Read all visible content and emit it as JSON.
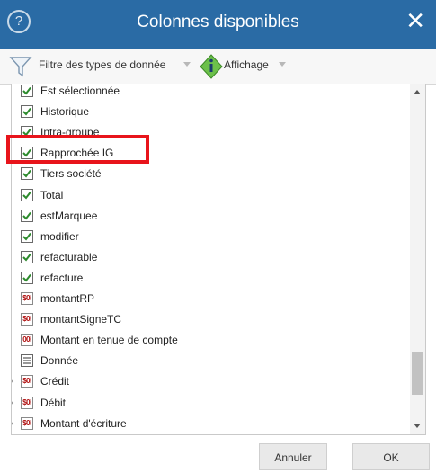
{
  "dialog": {
    "title": "Colonnes disponibles",
    "help_glyph": "?",
    "close_glyph": "✕"
  },
  "toolbar": {
    "filter_label": "Filtre des types de donnée",
    "display_label": "Affichage"
  },
  "columns": [
    {
      "label": "Est sélectionnée",
      "icon": "checkbox-checked"
    },
    {
      "label": "Historique",
      "icon": "checkbox-checked"
    },
    {
      "label": "Intra-groupe",
      "icon": "checkbox-checked"
    },
    {
      "label": "Rapprochée IG",
      "icon": "checkbox-checked"
    },
    {
      "label": "Tiers société",
      "icon": "checkbox-checked"
    },
    {
      "label": "Total",
      "icon": "checkbox-checked"
    },
    {
      "label": "estMarquee",
      "icon": "checkbox-checked"
    },
    {
      "label": "modifier",
      "icon": "checkbox-checked"
    },
    {
      "label": "refacturable",
      "icon": "checkbox-checked"
    },
    {
      "label": "refacture",
      "icon": "checkbox-checked"
    },
    {
      "label": "montantRP",
      "icon": "currency-icon",
      "badge": "$0l"
    },
    {
      "label": "montantSigneTC",
      "icon": "currency-icon",
      "badge": "$0l"
    },
    {
      "label": "Montant en tenue de compte",
      "icon": "amount-icon",
      "badge": "00l"
    },
    {
      "label": "Donnée",
      "icon": "data-list-icon"
    },
    {
      "label": "Crédit",
      "icon": "currency-icon",
      "badge": "$0l",
      "expandable": true
    },
    {
      "label": "Débit",
      "icon": "currency-icon",
      "badge": "$0l",
      "expandable": true
    },
    {
      "label": "Montant d'écriture",
      "icon": "currency-icon",
      "badge": "$0l",
      "expandable": true
    }
  ],
  "buttons": {
    "cancel_label": "Annuler",
    "ok_label": "OK"
  },
  "colors": {
    "title_bar": "#2a6ba5",
    "highlight": "#e8141b",
    "check": "#2c8a2c"
  }
}
